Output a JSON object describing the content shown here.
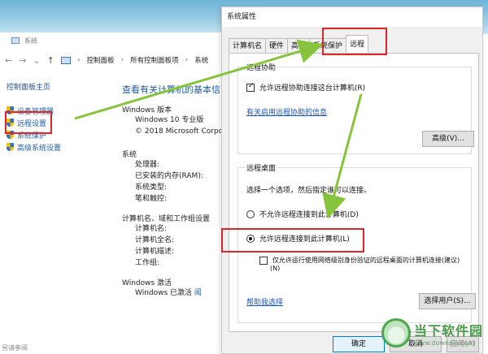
{
  "background_window": {
    "title": "系统",
    "address": {
      "crumbs": [
        "控制面板",
        "所有控制面板项",
        "系统"
      ]
    },
    "leftnav": {
      "home": "控制面板主页",
      "items": [
        {
          "label": "设备管理器"
        },
        {
          "label": "远程设置"
        },
        {
          "label": "系统保护"
        },
        {
          "label": "高级系统设置"
        }
      ]
    },
    "main": {
      "heading": "查看有关计算机的基本信",
      "edition_section": "Windows 版本",
      "edition": "Windows 10 专业版",
      "copyright": "© 2018 Microsoft Corpo",
      "system_section": "系统",
      "system_rows": [
        "处理器:",
        "已安装的内存(RAM):",
        "系统类型:",
        "笔和触控:"
      ],
      "computer_section": "计算机名、域和工作组设置",
      "computer_rows": [
        "计算机名:",
        "计算机全名:",
        "计算机描述:",
        "工作组:"
      ],
      "activation_section": "Windows 激活",
      "activation_status": "Windows 已激活",
      "activation_link": "阅",
      "footer_hint": "另请参阅"
    }
  },
  "dialog": {
    "title": "系统属性",
    "tabs": [
      {
        "label": "计算机名",
        "active": false
      },
      {
        "label": "硬件",
        "active": false
      },
      {
        "label": "高级",
        "active": false
      },
      {
        "label": "系统保护",
        "active": false
      },
      {
        "label": "远程",
        "active": true
      }
    ],
    "remote_assistance": {
      "group_title": "远程协助",
      "checkbox_label": "允许远程协助连接这台计算机(R)",
      "checked": true,
      "help_link": "有关启用远程协助的信息",
      "advanced_button": "高级(V)..."
    },
    "remote_desktop": {
      "group_title": "远程桌面",
      "instruction": "选择一个选项，然后指定谁可以连接。",
      "option_deny": "不允许远程连接到此计算机(D)",
      "option_allow": "允许远程连接到此计算机(L)",
      "selected": "allow",
      "nla_label": "仅允许运行使用网络级别身份验证的远程桌面的计算机连接(建议)",
      "nla_suffix": "(N)",
      "nla_checked": false,
      "help_link": "帮助我选择",
      "select_users_button": "选择用户(S)..."
    },
    "buttons": {
      "ok": "确定",
      "cancel": "取消",
      "apply": "应用(A)"
    }
  },
  "annotations": {
    "highlight_color": "#e0252a",
    "arrow_color": "#86c43c"
  },
  "watermark": {
    "brand": "当下软件园",
    "url": "www.downxia.com"
  }
}
